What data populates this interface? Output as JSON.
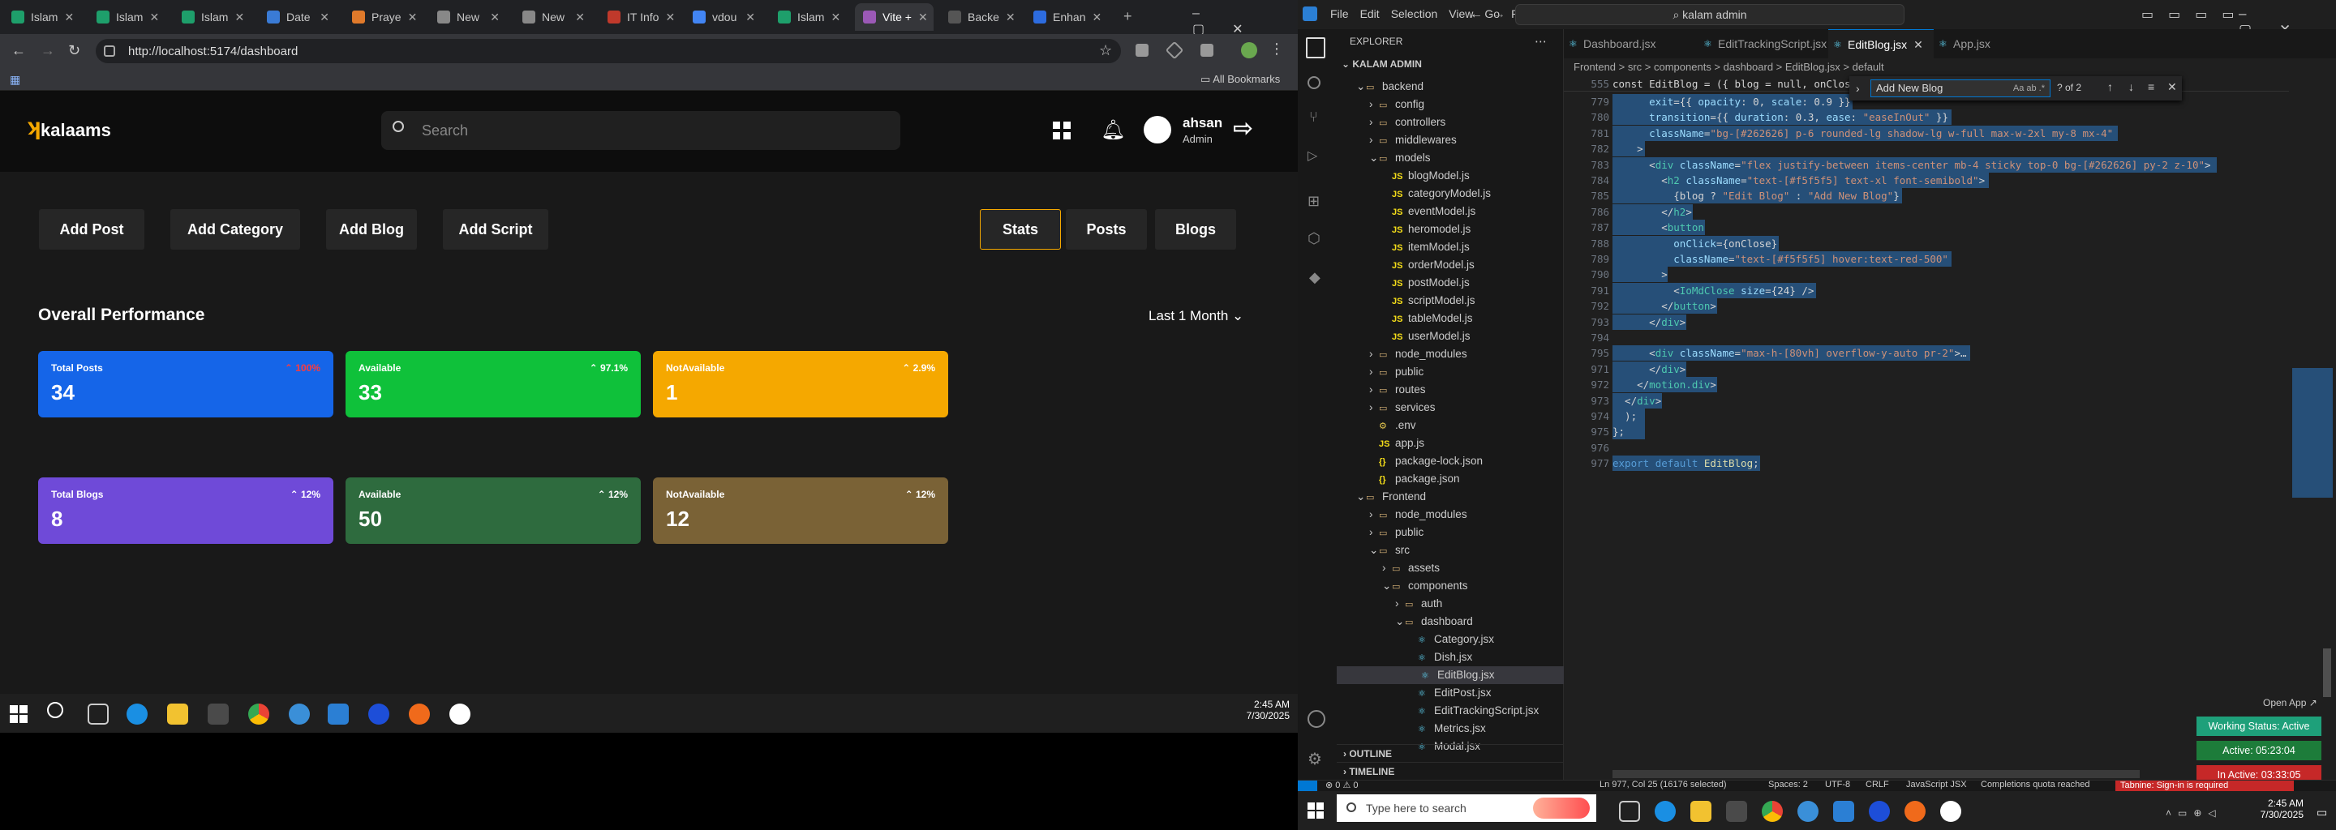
{
  "browser": {
    "tabs": [
      "Islam",
      "Islam",
      "Islam",
      "Date",
      "Praye",
      "New",
      "New",
      "IT Info",
      "vdou",
      "Islam",
      "Vite +",
      "Backe",
      "Enhan"
    ],
    "active_tab_index": 10,
    "url": "http://localhost:5174/dashboard",
    "bookmarks_label": "All Bookmarks"
  },
  "app": {
    "brand": "kalaams",
    "search_placeholder": "Search",
    "user": {
      "name": "ahsan",
      "role": "Admin"
    },
    "nav_left": [
      "Add Post",
      "Add Category",
      "Add Blog",
      "Add Script"
    ],
    "nav_right": [
      "Stats",
      "Posts",
      "Blogs"
    ],
    "active_nav": "Stats",
    "section_title": "Overall Performance",
    "period": "Last 1 Month",
    "cards_row1": [
      {
        "label": "Total Posts",
        "value": "34",
        "change": "100%",
        "color": "#1565e8",
        "change_color": "#ff3b3b"
      },
      {
        "label": "Available",
        "value": "33",
        "change": "97.1%",
        "color": "#0fc13a",
        "change_color": "#ffffff"
      },
      {
        "label": "NotAvailable",
        "value": "1",
        "change": "2.9%",
        "color": "#f5a800",
        "change_color": "#ffffff"
      }
    ],
    "cards_row2": [
      {
        "label": "Total Blogs",
        "value": "8",
        "change": "12%",
        "color": "#6f4ad8",
        "change_color": "#ffffff"
      },
      {
        "label": "Available",
        "value": "50",
        "change": "12%",
        "color": "#2e6b3e",
        "change_color": "#ffffff"
      },
      {
        "label": "NotAvailable",
        "value": "12",
        "change": "12%",
        "color": "#7a6236",
        "change_color": "#ffffff"
      }
    ]
  },
  "left_taskbar": {
    "time": "2:45 AM",
    "date": "7/30/2025"
  },
  "vscode": {
    "menu": [
      "File",
      "Edit",
      "Selection",
      "View",
      "Go",
      "Run"
    ],
    "search_box": "kalam admin",
    "explorer_title": "EXPLORER",
    "root": "KALAM ADMIN",
    "tree": [
      {
        "d": 1,
        "t": "backend",
        "k": "fo"
      },
      {
        "d": 2,
        "t": "config",
        "k": "fc"
      },
      {
        "d": 2,
        "t": "controllers",
        "k": "fc"
      },
      {
        "d": 2,
        "t": "middlewares",
        "k": "fc"
      },
      {
        "d": 2,
        "t": "models",
        "k": "fo"
      },
      {
        "d": 3,
        "t": "blogModel.js",
        "k": "js"
      },
      {
        "d": 3,
        "t": "categoryModel.js",
        "k": "js"
      },
      {
        "d": 3,
        "t": "eventModel.js",
        "k": "js"
      },
      {
        "d": 3,
        "t": "heromodel.js",
        "k": "js"
      },
      {
        "d": 3,
        "t": "itemModel.js",
        "k": "js"
      },
      {
        "d": 3,
        "t": "orderModel.js",
        "k": "js"
      },
      {
        "d": 3,
        "t": "postModel.js",
        "k": "js"
      },
      {
        "d": 3,
        "t": "scriptModel.js",
        "k": "js"
      },
      {
        "d": 3,
        "t": "tableModel.js",
        "k": "js"
      },
      {
        "d": 3,
        "t": "userModel.js",
        "k": "js"
      },
      {
        "d": 2,
        "t": "node_modules",
        "k": "fc"
      },
      {
        "d": 2,
        "t": "public",
        "k": "fc"
      },
      {
        "d": 2,
        "t": "routes",
        "k": "fc"
      },
      {
        "d": 2,
        "t": "services",
        "k": "fc"
      },
      {
        "d": 2,
        "t": ".env",
        "k": "cfg"
      },
      {
        "d": 2,
        "t": "app.js",
        "k": "js"
      },
      {
        "d": 2,
        "t": "package-lock.json",
        "k": "json"
      },
      {
        "d": 2,
        "t": "package.json",
        "k": "json"
      },
      {
        "d": 1,
        "t": "Frontend",
        "k": "fo"
      },
      {
        "d": 2,
        "t": "node_modules",
        "k": "fc"
      },
      {
        "d": 2,
        "t": "public",
        "k": "fc"
      },
      {
        "d": 2,
        "t": "src",
        "k": "fo"
      },
      {
        "d": 3,
        "t": "assets",
        "k": "fc"
      },
      {
        "d": 3,
        "t": "components",
        "k": "fo"
      },
      {
        "d": 4,
        "t": "auth",
        "k": "fc"
      },
      {
        "d": 4,
        "t": "dashboard",
        "k": "fo"
      },
      {
        "d": 5,
        "t": "Category.jsx",
        "k": "jsx"
      },
      {
        "d": 5,
        "t": "Dish.jsx",
        "k": "jsx"
      },
      {
        "d": 5,
        "t": "EditBlog.jsx",
        "k": "jsx",
        "sel": true
      },
      {
        "d": 5,
        "t": "EditPost.jsx",
        "k": "jsx"
      },
      {
        "d": 5,
        "t": "EditTrackingScript.jsx",
        "k": "jsx"
      },
      {
        "d": 5,
        "t": "Metrics.jsx",
        "k": "jsx"
      },
      {
        "d": 5,
        "t": "Modal.jsx",
        "k": "jsx"
      }
    ],
    "outline": "OUTLINE",
    "timeline": "TIMELINE",
    "tabs": [
      "Dashboard.jsx",
      "EditTrackingScript.jsx",
      "EditBlog.jsx",
      "App.jsx"
    ],
    "active_tab": "EditBlog.jsx",
    "breadcrumb": "Frontend > src > components > dashboard > EditBlog.jsx > default",
    "sticky_line": "555",
    "sticky_text": "const EditBlog = ({ blog = null, onClose }) => {",
    "find": {
      "value": "Add New Blog",
      "count": "? of 2"
    },
    "code": [
      {
        "n": "779",
        "h": "      exit={{ opacity: 0, scale: 0.9 }}"
      },
      {
        "n": "780",
        "h": "      transition={{ duration: 0.3, ease: \"easeInOut\" }}"
      },
      {
        "n": "781",
        "h": "      className=\"bg-[#262626] p-6 rounded-lg shadow-lg w-full max-w-2xl my-8 mx-4\""
      },
      {
        "n": "782",
        "h": "    >"
      },
      {
        "n": "783",
        "h": "      <div className=\"flex justify-between items-center mb-4 sticky top-0 bg-[#262626] py-2 z-10\">"
      },
      {
        "n": "784",
        "h": "        <h2 className=\"text-[#f5f5f5] text-xl font-semibold\">"
      },
      {
        "n": "785",
        "h": "          {blog ? \"Edit Blog\" : \"Add New Blog\"}"
      },
      {
        "n": "786",
        "h": "        </h2>"
      },
      {
        "n": "787",
        "h": "        <button"
      },
      {
        "n": "788",
        "h": "          onClick={onClose}"
      },
      {
        "n": "789",
        "h": "          className=\"text-[#f5f5f5] hover:text-red-500\""
      },
      {
        "n": "790",
        "h": "        >"
      },
      {
        "n": "791",
        "h": "          <IoMdClose size={24} />"
      },
      {
        "n": "792",
        "h": "        </button>"
      },
      {
        "n": "793",
        "h": "      </div>"
      },
      {
        "n": "794",
        "h": ""
      },
      {
        "n": "795",
        "h": "      <div className=\"max-h-[80vh] overflow-y-auto pr-2\">…"
      },
      {
        "n": "971",
        "h": "      </div>"
      },
      {
        "n": "972",
        "h": "    </motion.div>"
      },
      {
        "n": "973",
        "h": "  </div>"
      },
      {
        "n": "974",
        "h": "  );"
      },
      {
        "n": "975",
        "h": "};"
      },
      {
        "n": "976",
        "h": ""
      },
      {
        "n": "977",
        "h": "export default EditBlog;"
      }
    ],
    "status": {
      "errors": "0",
      "warnings": "0",
      "position": "Ln 977, Col 25 (16176 selected)",
      "spaces": "Spaces: 2",
      "encoding": "UTF-8",
      "eol": "CRLF",
      "language": "JavaScript JSX",
      "quota": "Completions quota reached",
      "tabnine": "Tabnine: Sign-in is required"
    },
    "open_app": "Open App ↗",
    "working_status": "Working Status: Active",
    "active_time": "Active: 05:23:04",
    "inactive_time": "In Active: 03:33:05",
    "taskbar": {
      "search": "Type here to search",
      "time": "2:45 AM",
      "date": "7/30/2025"
    }
  }
}
